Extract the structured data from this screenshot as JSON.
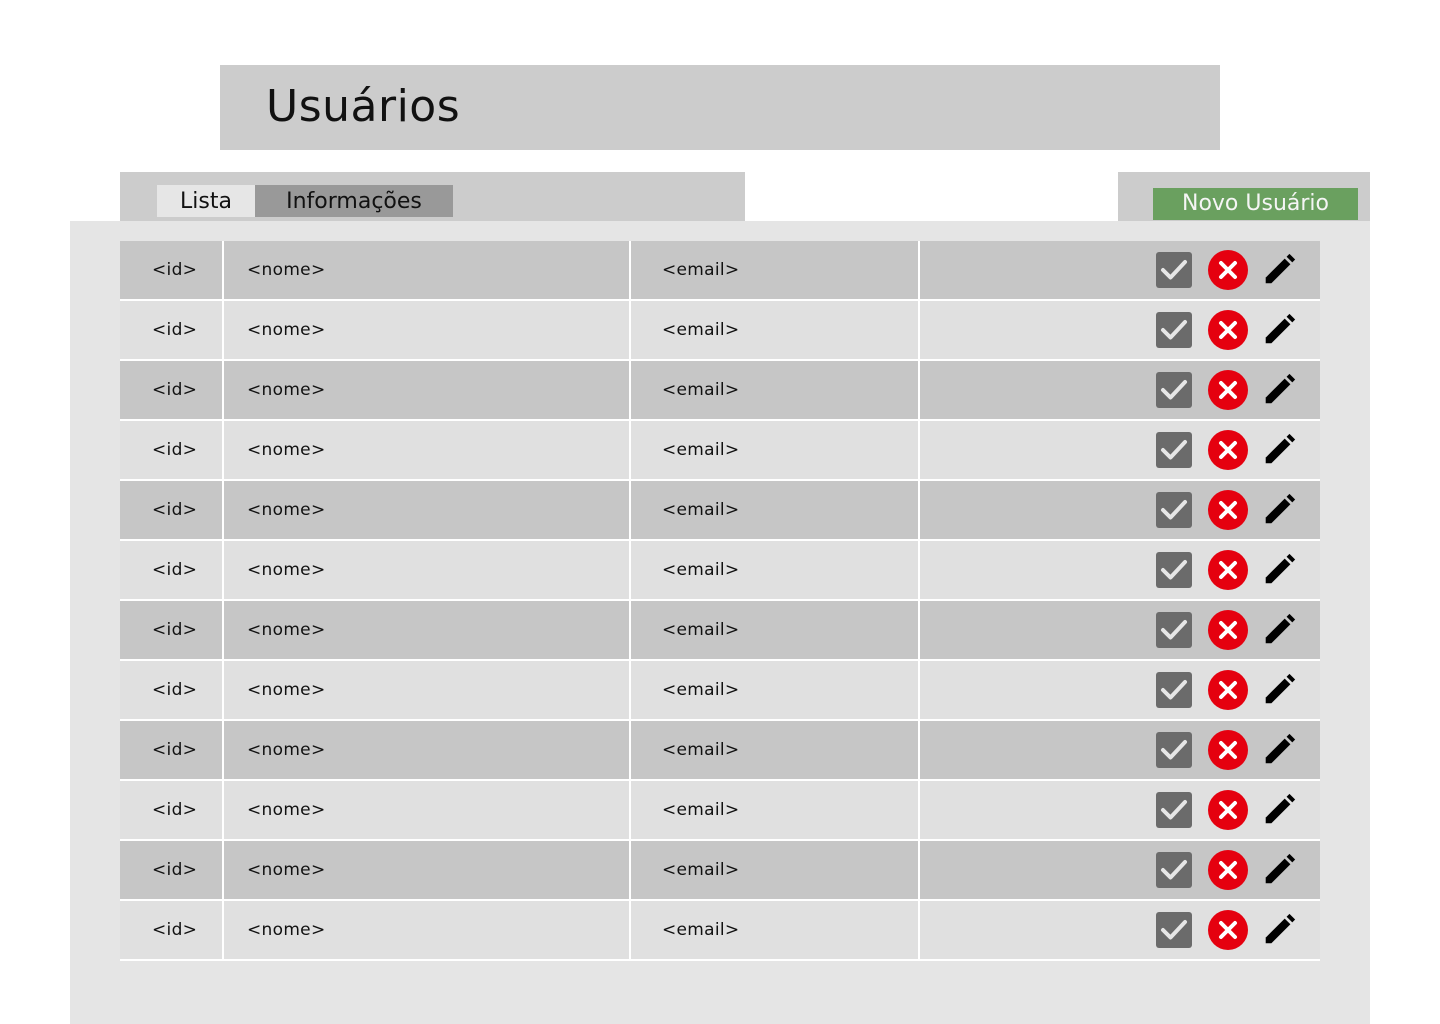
{
  "header": {
    "title": "Usuários"
  },
  "tabs": [
    {
      "label": "Lista",
      "active": true
    },
    {
      "label": "Informações",
      "active": false
    }
  ],
  "actions": {
    "new_user_label": "Novo Usuário"
  },
  "colors": {
    "accent_green": "#6aa05f",
    "delete_red": "#e5000f",
    "approve_gray": "#6b6b6b"
  },
  "icons": {
    "approve": "check-icon",
    "delete": "close-circle-icon",
    "edit": "pencil-icon"
  },
  "table": {
    "rows": [
      {
        "id": "<id>",
        "nome": "<nome>",
        "email": "<email>"
      },
      {
        "id": "<id>",
        "nome": "<nome>",
        "email": "<email>"
      },
      {
        "id": "<id>",
        "nome": "<nome>",
        "email": "<email>"
      },
      {
        "id": "<id>",
        "nome": "<nome>",
        "email": "<email>"
      },
      {
        "id": "<id>",
        "nome": "<nome>",
        "email": "<email>"
      },
      {
        "id": "<id>",
        "nome": "<nome>",
        "email": "<email>"
      },
      {
        "id": "<id>",
        "nome": "<nome>",
        "email": "<email>"
      },
      {
        "id": "<id>",
        "nome": "<nome>",
        "email": "<email>"
      },
      {
        "id": "<id>",
        "nome": "<nome>",
        "email": "<email>"
      },
      {
        "id": "<id>",
        "nome": "<nome>",
        "email": "<email>"
      },
      {
        "id": "<id>",
        "nome": "<nome>",
        "email": "<email>"
      },
      {
        "id": "<id>",
        "nome": "<nome>",
        "email": "<email>"
      }
    ]
  }
}
